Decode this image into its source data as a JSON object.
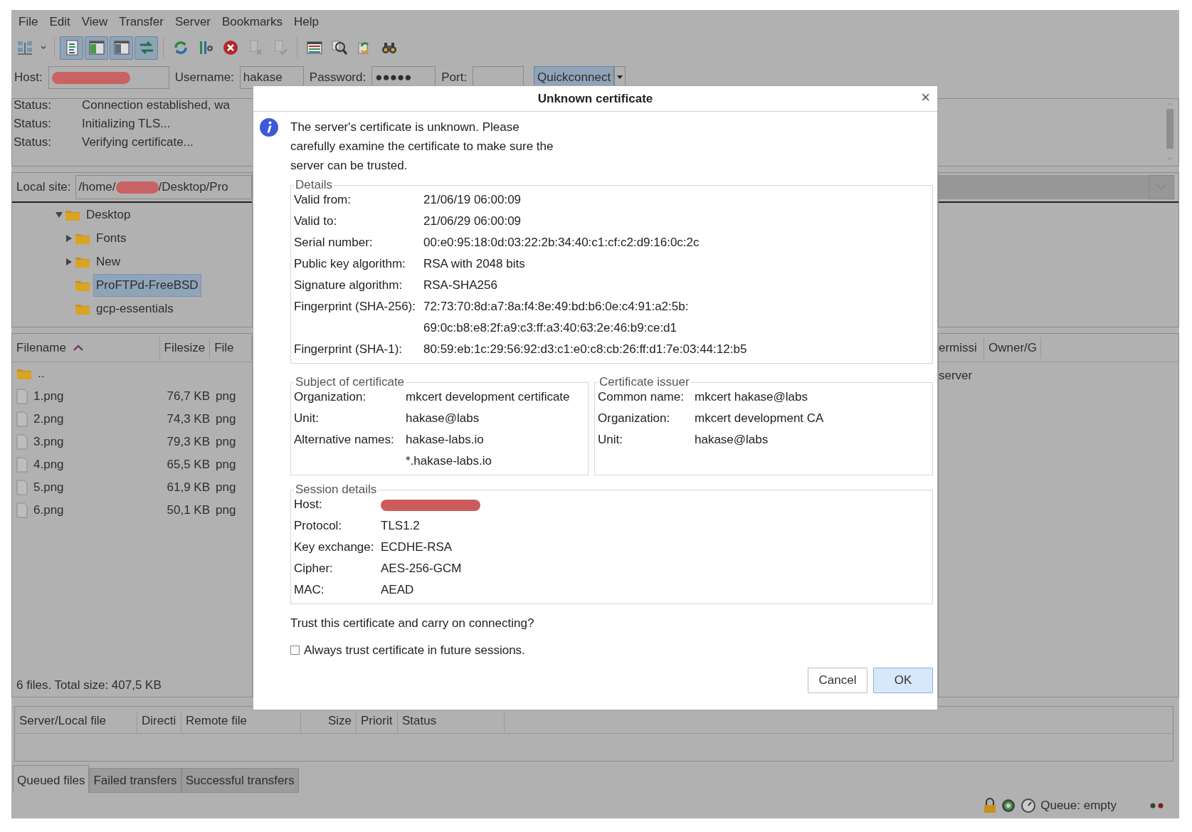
{
  "menu": [
    "File",
    "Edit",
    "View",
    "Transfer",
    "Server",
    "Bookmarks",
    "Help"
  ],
  "toolbar": [
    [
      {
        "pressed": false,
        "disabled": false
      }
    ],
    [
      {
        "pressed": true,
        "disabled": false
      },
      {
        "pressed": true,
        "disabled": false
      },
      {
        "pressed": true,
        "disabled": false
      },
      {
        "pressed": true,
        "disabled": false
      }
    ],
    [
      {
        "pressed": false,
        "disabled": false
      },
      {
        "pressed": false,
        "disabled": false
      },
      {
        "pressed": false,
        "disabled": false
      },
      {
        "pressed": false,
        "disabled": true
      },
      {
        "pressed": false,
        "disabled": true
      }
    ],
    [
      {
        "pressed": false,
        "disabled": false
      },
      {
        "pressed": false,
        "disabled": false
      },
      {
        "pressed": false,
        "disabled": false
      },
      {
        "pressed": false,
        "disabled": false
      }
    ]
  ],
  "quickconnect": {
    "host": {
      "label": "Host:",
      "redacted": true
    },
    "username": {
      "label": "Username:",
      "value": "hakase"
    },
    "password": {
      "label": "Password:",
      "value": "●●●●●"
    },
    "port": {
      "label": "Port:"
    },
    "button": "Quickconnect"
  },
  "log": [
    {
      "label": "Status:",
      "text": "Connection established, wa"
    },
    {
      "label": "Status:",
      "text": "Initializing TLS..."
    },
    {
      "label": "Status:",
      "text": "Verifying certificate..."
    }
  ],
  "local_site": {
    "label": "Local site:",
    "path_start": "/home/",
    "redacted": true,
    "path_end": "/Desktop/Pro"
  },
  "tree": [
    {
      "name": "Desktop",
      "expanded": true,
      "selected": false,
      "children": [
        {
          "name": "Fonts",
          "expanded": false,
          "selected": false
        },
        {
          "name": "New",
          "expanded": false,
          "selected": false
        },
        {
          "name": "ProFTPd-FreeBSD",
          "selected": true
        },
        {
          "name": "gcp-essentials",
          "selected": false
        }
      ]
    }
  ],
  "local_files": {
    "columns": [
      {
        "label": "Filename",
        "sorted": true
      },
      {
        "label": "Filesize",
        "sorted": false
      },
      {
        "label": "File",
        "sorted": false
      }
    ],
    "rows": [
      {
        "kind": "folder",
        "name": ".."
      },
      {
        "kind": "file",
        "name": "1.png",
        "size": "76,7 KB",
        "type": "png"
      },
      {
        "kind": "file",
        "name": "2.png",
        "size": "74,3 KB",
        "type": "png"
      },
      {
        "kind": "file",
        "name": "3.png",
        "size": "79,3 KB",
        "type": "png"
      },
      {
        "kind": "file",
        "name": "4.png",
        "size": "65,5 KB",
        "type": "png"
      },
      {
        "kind": "file",
        "name": "5.png",
        "size": "61,9 KB",
        "type": "png"
      },
      {
        "kind": "file",
        "name": "6.png",
        "size": "50,1 KB",
        "type": "png"
      }
    ],
    "summary": "6 files. Total size: 407,5 KB"
  },
  "remote_files": {
    "columns": [
      "ermissi",
      "Owner/G"
    ],
    "message": "server"
  },
  "dialog": {
    "title": "Unknown certificate",
    "close": "×",
    "intro": "The server's certificate is unknown. Please carefully examine the certificate to make sure the server can be trusted.",
    "details": {
      "legend": "Details",
      "rows": [
        {
          "label": "Valid from:",
          "lines": [
            "21/06/19 06:00:09"
          ]
        },
        {
          "label": "Valid to:",
          "lines": [
            "21/06/29 06:00:09"
          ]
        },
        {
          "label": "Serial number:",
          "lines": [
            "00:e0:95:18:0d:03:22:2b:34:40:c1:cf:c2:d9:16:0c:2c"
          ]
        },
        {
          "label": "Public key algorithm:",
          "lines": [
            "RSA with 2048 bits"
          ]
        },
        {
          "label": "Signature algorithm:",
          "lines": [
            "RSA-SHA256"
          ]
        },
        {
          "label": "Fingerprint (SHA-256):",
          "lines": [
            "72:73:70:8d:a7:8a:f4:8e:49:bd:b6:0e:c4:91:a2:5b:",
            "69:0c:b8:e8:2f:a9:c3:ff:a3:40:63:2e:46:b9:ce:d1"
          ]
        },
        {
          "label": "Fingerprint (SHA-1):",
          "lines": [
            "80:59:eb:1c:29:56:92:d3:c1:e0:c8:cb:26:ff:d1:7e:03:44:12:b5"
          ]
        }
      ]
    },
    "subject": {
      "legend": "Subject of certificate",
      "rows": [
        {
          "label": "Organization:",
          "lines": [
            "mkcert development certificate"
          ]
        },
        {
          "label": "Unit:",
          "lines": [
            "hakase@labs"
          ]
        },
        {
          "label": "Alternative names:",
          "lines": [
            "hakase-labs.io",
            "*.hakase-labs.io"
          ]
        }
      ]
    },
    "issuer": {
      "legend": "Certificate issuer",
      "rows": [
        {
          "label": "Common name:",
          "lines": [
            "mkcert hakase@labs"
          ]
        },
        {
          "label": "Organization:",
          "lines": [
            "mkcert development CA"
          ]
        },
        {
          "label": "Unit:",
          "lines": [
            "hakase@labs"
          ]
        }
      ]
    },
    "session": {
      "legend": "Session details",
      "rows": [
        {
          "label": "Host:",
          "redacted": true
        },
        {
          "label": "Protocol:",
          "lines": [
            "TLS1.2"
          ]
        },
        {
          "label": "Key exchange:",
          "lines": [
            "ECDHE-RSA"
          ]
        },
        {
          "label": "Cipher:",
          "lines": [
            "AES-256-GCM"
          ]
        },
        {
          "label": "MAC:",
          "lines": [
            "AEAD"
          ]
        }
      ]
    },
    "question": "Trust this certificate and carry on connecting?",
    "checkbox": {
      "label": "Always trust certificate in future sessions.",
      "checked": false
    },
    "buttons": [
      {
        "label": "Cancel",
        "default": false
      },
      {
        "label": "OK",
        "default": true
      }
    ]
  },
  "queue": {
    "columns": [
      "Server/Local file",
      "Directi",
      "Remote file",
      "Size",
      "Priorit",
      "Status"
    ]
  },
  "tabs": [
    {
      "label": "Queued files",
      "selected": true
    },
    {
      "label": "Failed transfers",
      "selected": false
    },
    {
      "label": "Successful transfers",
      "selected": false
    }
  ],
  "status_bar": {
    "queue": "Queue: empty"
  }
}
